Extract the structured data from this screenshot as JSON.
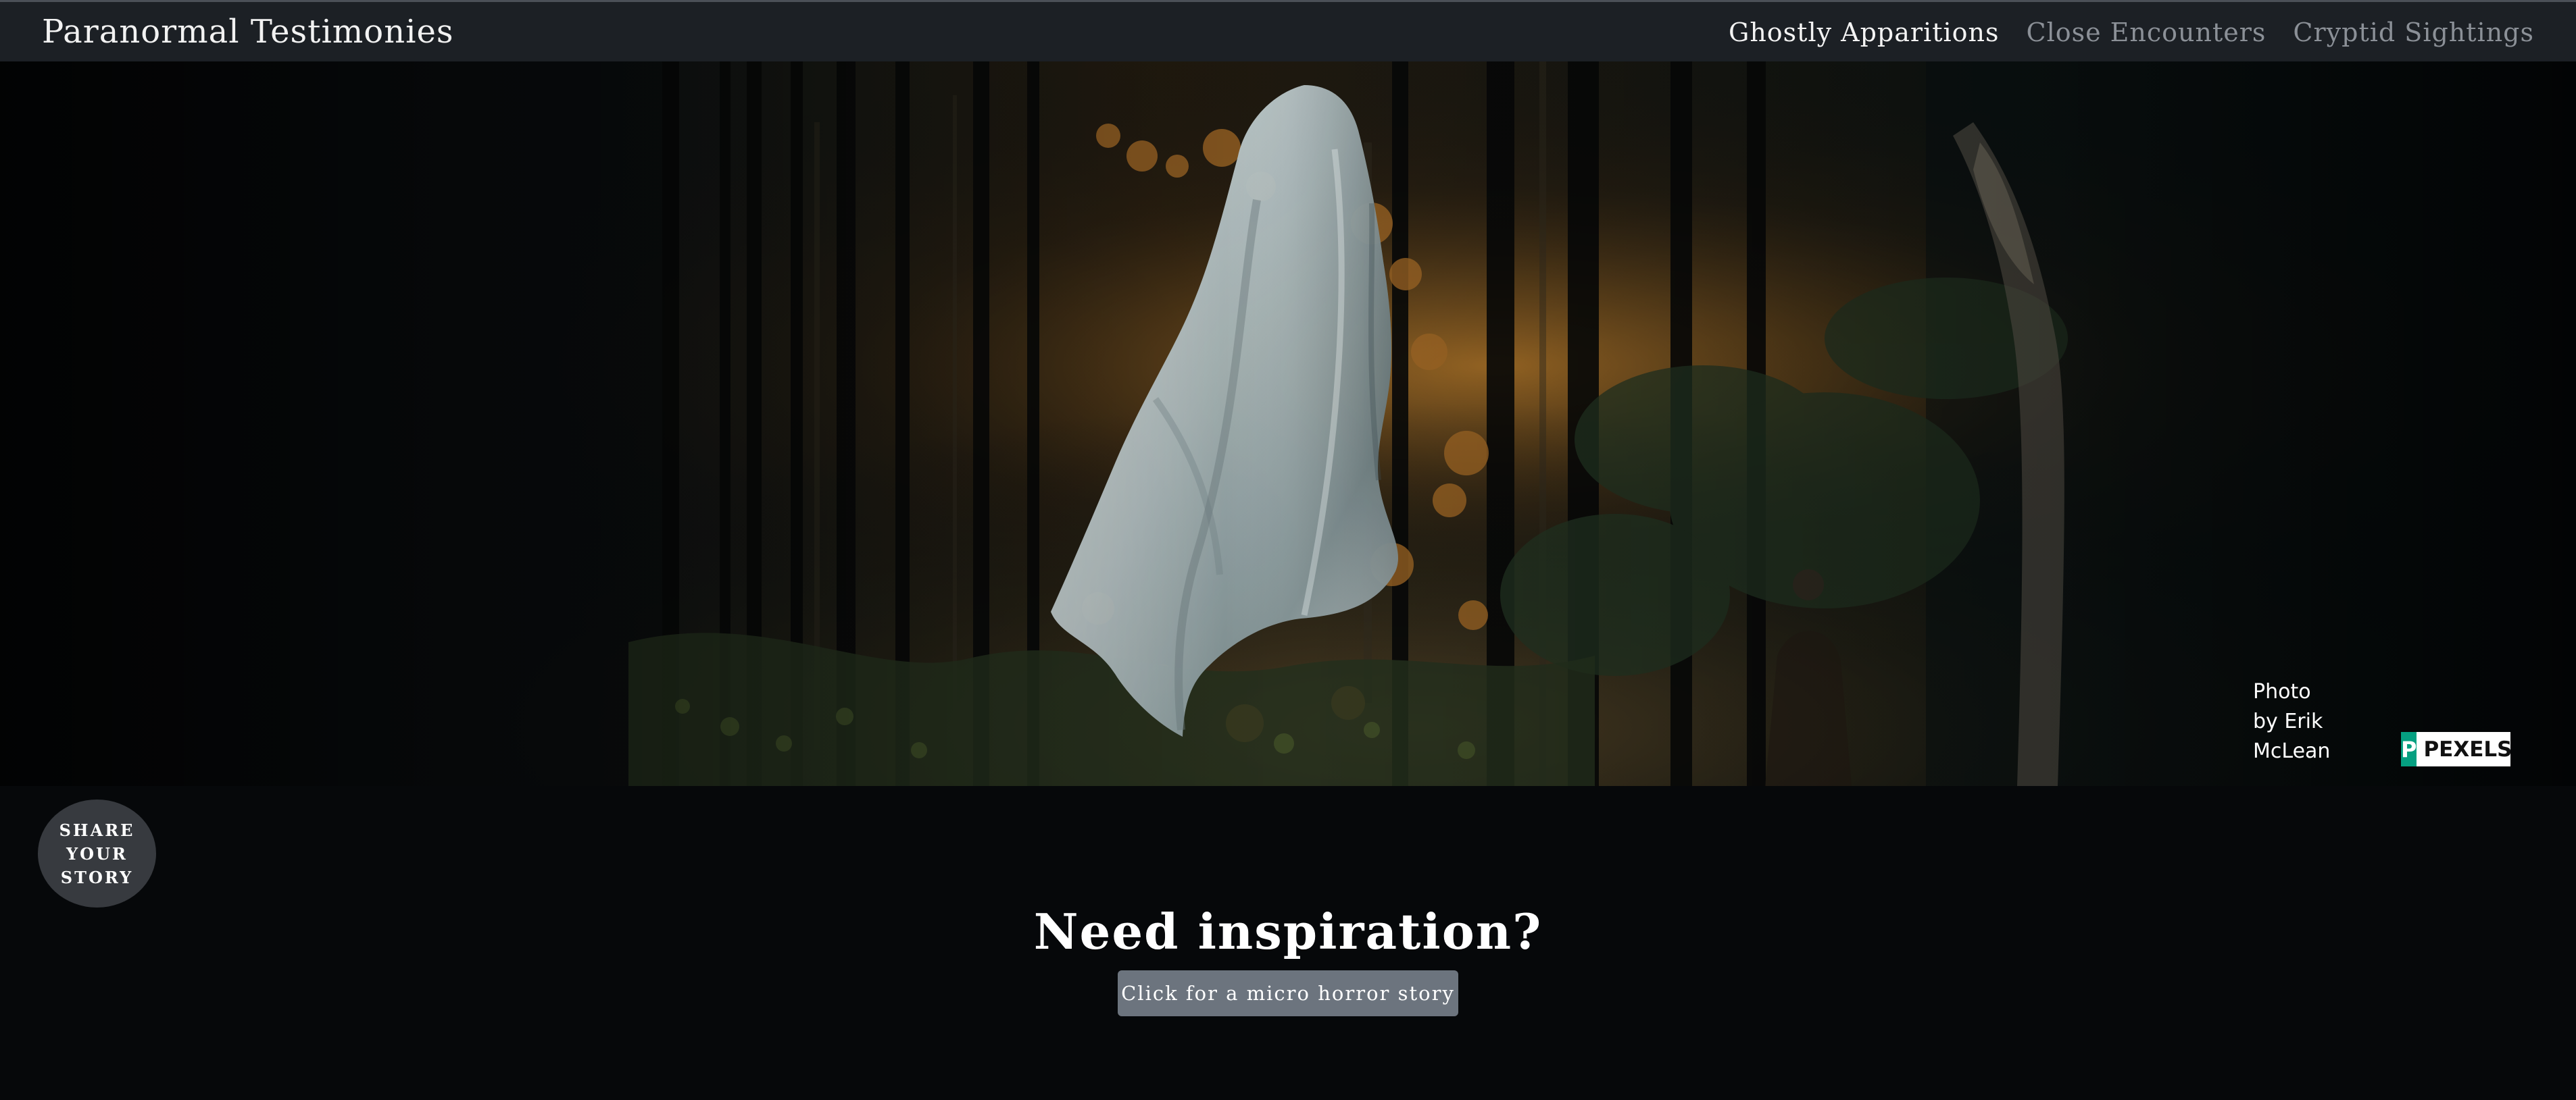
{
  "brand": {
    "title": "Paranormal Testimonies"
  },
  "nav": {
    "items": [
      {
        "label": "Ghostly Apparitions",
        "active": true
      },
      {
        "label": "Close Encounters",
        "active": false
      },
      {
        "label": "Cryptid Sightings",
        "active": false
      }
    ]
  },
  "hero": {
    "image": "floating-sheet-ghost-forest",
    "credit": {
      "line1": "Photo",
      "line2": "by Erik",
      "line3": "McLean"
    },
    "pexels": {
      "mark": "P",
      "label": "PEXELS"
    }
  },
  "share": {
    "line1": "SHARE",
    "line2": "YOUR",
    "line3": "STORY"
  },
  "inspiration": {
    "title": "Need inspiration?",
    "button_label": "Click for a micro horror story"
  },
  "colors": {
    "nav_background": "#1c2025",
    "page_background": "#06080a",
    "button_gray": "#6c747e",
    "share_circle": "#373a3f",
    "pexels_green": "#05a081"
  }
}
